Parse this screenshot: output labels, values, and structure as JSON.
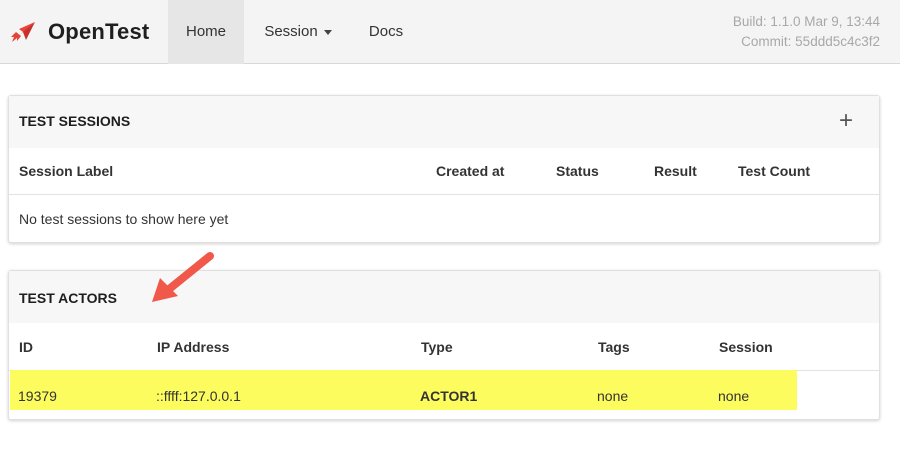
{
  "app": {
    "brand": "OpenTest",
    "build": "Build: 1.1.0 Mar 9, 13:44",
    "commit": "Commit: 55ddd5c4c3f2"
  },
  "nav": {
    "home": "Home",
    "session": "Session",
    "docs": "Docs"
  },
  "sessions": {
    "title": "TEST SESSIONS",
    "add": "+",
    "columns": {
      "label": "Session Label",
      "created": "Created at",
      "status": "Status",
      "result": "Result",
      "count": "Test Count"
    },
    "empty": "No test sessions to show here yet"
  },
  "actors": {
    "title": "TEST ACTORS",
    "columns": {
      "id": "ID",
      "ip": "IP Address",
      "type": "Type",
      "tags": "Tags",
      "session": "Session"
    },
    "rows": [
      {
        "id": "19379",
        "ip": "::ffff:127.0.0.1",
        "type": "ACTOR1",
        "tags": "none",
        "session": "none"
      }
    ]
  },
  "colors": {
    "brand_icon": "#e8433a",
    "highlight": "#fdfc5e",
    "arrow": "#f0584a",
    "build_text": "#a8a8a8"
  },
  "icons": {
    "brand": "rocket-icon",
    "session_dropdown": "caret-down-icon",
    "add_session": "plus-icon",
    "annotation": "arrow-icon"
  }
}
